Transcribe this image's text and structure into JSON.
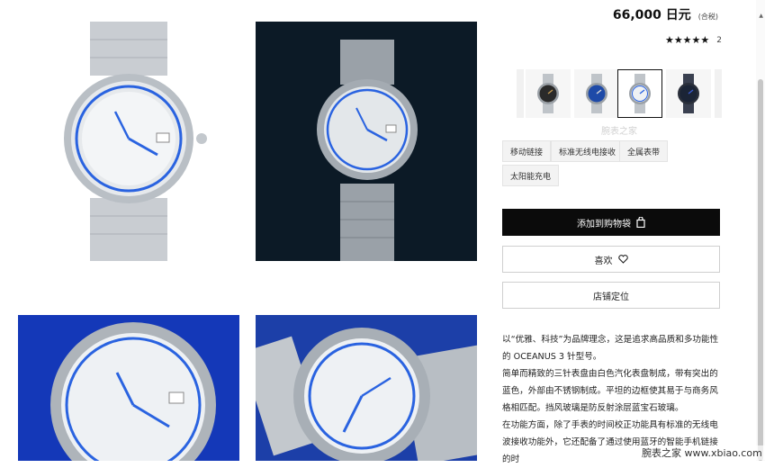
{
  "product": {
    "price": "66,000 日元",
    "tax_note": "(合税)",
    "stars": "★★★★★",
    "review_count": "2"
  },
  "variants": [
    {
      "name": "black-dial-watch-thumb",
      "dial": "#2a2a2a",
      "accent": "#c49a52",
      "active": false
    },
    {
      "name": "blue-dial-watch-thumb",
      "dial": "#1e4aa8",
      "accent": "#d8d8d8",
      "active": false
    },
    {
      "name": "white-dial-watch-thumb",
      "dial": "#eef1f4",
      "accent": "#2a63e0",
      "active": true
    },
    {
      "name": "navy-watch-thumb",
      "dial": "#1b2436",
      "accent": "#3a5bd0",
      "active": false
    }
  ],
  "tags": [
    "移动链接",
    "标准无线电接收",
    "全属表带",
    "太阳能充电"
  ],
  "buttons": {
    "add_to_cart": "添加到购物袋",
    "like": "喜欢",
    "store_locator": "店铺定位"
  },
  "description": {
    "p1": "以“优雅、科技”为品牌理念，这是追求高品质和多功能性的 OCEANUS 3 针型号。",
    "p2": "简单而精致的三针表盘由白色汽化表盘制成，带有突出的蓝色，外部由不锈钢制成。平坦的边框使其易于与商务风格相匹配。挡风玻璃是防反射涂层蓝宝石玻璃。",
    "p3": "在功能方面，除了手表的时间校正功能具有标准的无线电波接收功能外，它还配备了通过使用蓝牙的智能手机链接的时"
  },
  "watermarks": {
    "center": "腕表之家",
    "corner": "腕表之家 www.xbiao.com"
  },
  "colors": {
    "accent_blue": "#2a63e0",
    "cart_button_bg": "#0b0b0b",
    "tile_dark": "#0c1a26",
    "tile_blue": "#1438b8"
  }
}
